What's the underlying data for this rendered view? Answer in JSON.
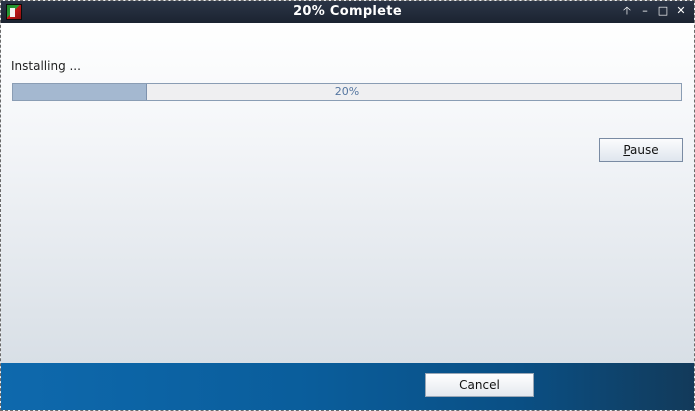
{
  "window": {
    "title": "20% Complete",
    "controls": {
      "restore": "🡡",
      "minimize": "–",
      "maximize": "□",
      "close": "✕"
    }
  },
  "main": {
    "status_text": "Installing ...",
    "progress": {
      "percent": 20,
      "label": "20%"
    },
    "pause_button": {
      "label_rest": "ause",
      "mnemonic": "P"
    }
  },
  "footer": {
    "cancel_label": "Cancel"
  },
  "colors": {
    "titlebar": "#1f2837",
    "progress_fill": "#a4b8d0",
    "progress_text": "#5576a0",
    "footer_blue": "#0e69ad"
  }
}
